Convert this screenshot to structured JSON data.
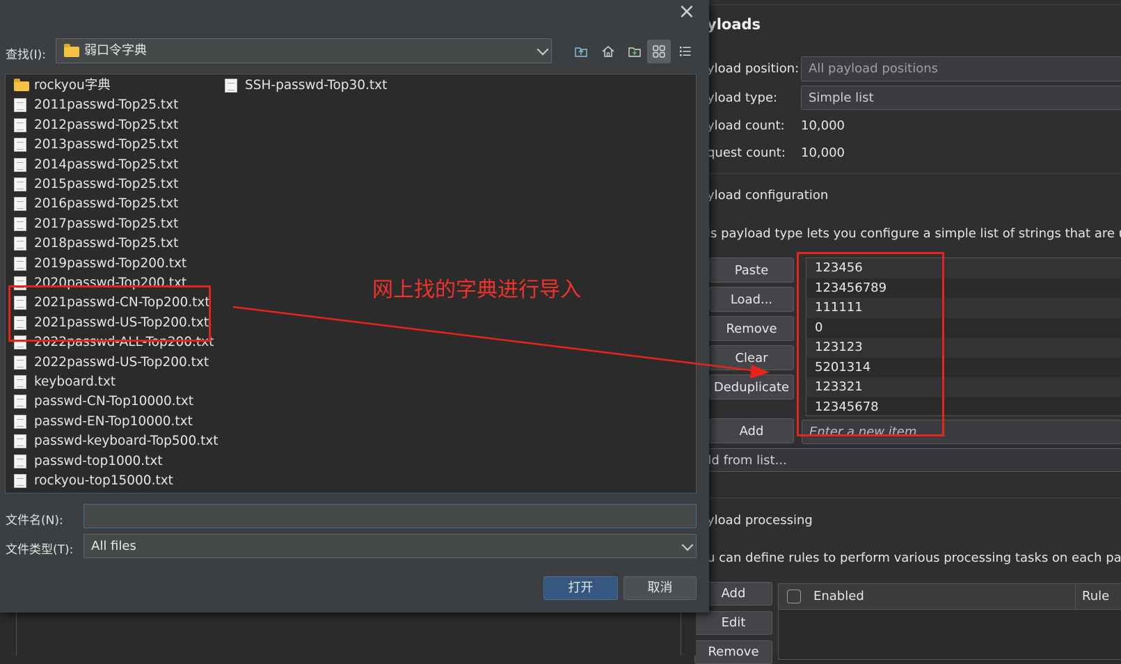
{
  "burp": {
    "title": "yloads",
    "payload_position_label": "yload position:",
    "payload_position_value": "All payload positions",
    "payload_type_label": "yload type:",
    "payload_type_value": "Simple list",
    "payload_count_label": "yload count:",
    "payload_count_value": "10,000",
    "request_count_label": "quest count:",
    "request_count_value": "10,000",
    "config_heading": "yload configuration",
    "config_desc": "is payload type lets you configure a simple list of strings that are use",
    "buttons": {
      "paste": "Paste",
      "load": "Load...",
      "remove": "Remove",
      "clear": "Clear",
      "deduplicate": "Deduplicate",
      "add": "Add"
    },
    "payload_items": [
      "123456",
      "123456789",
      "111111",
      "0",
      "123123",
      "5201314",
      "123321",
      "12345678"
    ],
    "add_placeholder": "Enter a new item",
    "add_from_list": "dd from list...",
    "processing_heading": "yload processing",
    "processing_desc": "u can define rules to perform various processing tasks on each payloa",
    "processing_buttons": {
      "add": "Add",
      "edit": "Edit",
      "remove": "Remove"
    },
    "rules_table": {
      "enabled_header": "Enabled",
      "rule_header": "Rule"
    }
  },
  "dialog": {
    "close_icon": "close-icon",
    "look_in_label": "查找(I):",
    "look_in_value": "弱口令字典",
    "toolbar_icons": [
      "up-folder-icon",
      "home-icon",
      "new-folder-icon",
      "grid-view-icon",
      "list-view-icon"
    ],
    "files_col1": [
      {
        "name": "rockyou字典",
        "icon": "folder-icon"
      },
      {
        "name": "2011passwd-Top25.txt",
        "icon": "file-icon"
      },
      {
        "name": "2012passwd-Top25.txt",
        "icon": "file-icon"
      },
      {
        "name": "2013passwd-Top25.txt",
        "icon": "file-icon"
      },
      {
        "name": "2014passwd-Top25.txt",
        "icon": "file-icon"
      },
      {
        "name": "2015passwd-Top25.txt",
        "icon": "file-icon"
      },
      {
        "name": "2016passwd-Top25.txt",
        "icon": "file-icon"
      },
      {
        "name": "2017passwd-Top25.txt",
        "icon": "file-icon"
      },
      {
        "name": "2018passwd-Top25.txt",
        "icon": "file-icon"
      },
      {
        "name": "2019passwd-Top200.txt",
        "icon": "file-icon"
      },
      {
        "name": "2020passwd-Top200.txt",
        "icon": "file-icon"
      },
      {
        "name": "2021passwd-CN-Top200.txt",
        "icon": "file-icon"
      },
      {
        "name": "2021passwd-US-Top200.txt",
        "icon": "file-icon"
      },
      {
        "name": "2022passwd-ALL-Top200.txt",
        "icon": "file-icon"
      },
      {
        "name": "2022passwd-US-Top200.txt",
        "icon": "file-icon"
      },
      {
        "name": "keyboard.txt",
        "icon": "file-icon"
      },
      {
        "name": "passwd-CN-Top10000.txt",
        "icon": "file-icon"
      },
      {
        "name": "passwd-EN-Top10000.txt",
        "icon": "file-icon"
      },
      {
        "name": "passwd-keyboard-Top500.txt",
        "icon": "file-icon"
      },
      {
        "name": "passwd-top1000.txt",
        "icon": "file-icon"
      },
      {
        "name": "rockyou-top15000.txt",
        "icon": "file-icon"
      }
    ],
    "files_col2": [
      {
        "name": "SSH-passwd-Top30.txt",
        "icon": "file-icon"
      }
    ],
    "filename_label": "文件名(N):",
    "filename_value": "",
    "filetype_label": "文件类型(T):",
    "filetype_value": "All files",
    "open_button": "打开",
    "cancel_button": "取消"
  },
  "annotation": {
    "text": "网上找的字典进行导入",
    "color": "#f0322a"
  }
}
